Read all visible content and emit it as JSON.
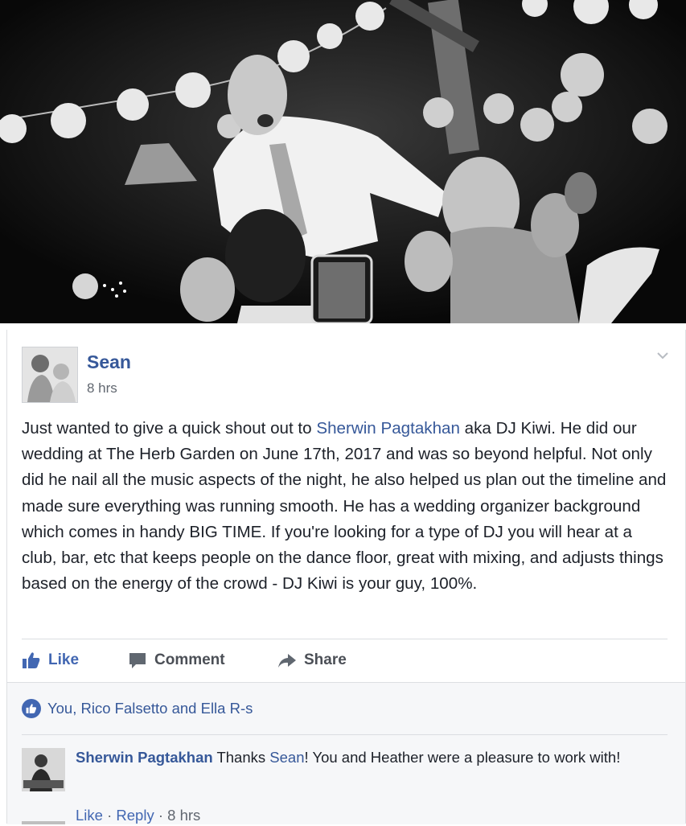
{
  "post": {
    "author": "Sean",
    "time": "8 hrs",
    "text_1": "Just wanted to give a quick shout out to ",
    "mention": "Sherwin Pagtakhan",
    "text_2": " aka DJ Kiwi. He did our wedding at The Herb Garden on June 17th, 2017 and was so beyond helpful. Not only did he nail all the music aspects of the night, he also helped us plan out the timeline and made sure everything was running smooth. He has a wedding organizer background which comes in handy BIG TIME. If you're looking for a type of DJ you will hear at a club, bar, etc that keeps people on the dance floor, great with mixing, and adjusts things based on the energy of the crowd - DJ Kiwi is your guy, 100%."
  },
  "actions": {
    "like": "Like",
    "comment": "Comment",
    "share": "Share"
  },
  "reactions": {
    "text": "You, Rico Falsetto and Ella R-s"
  },
  "comment": {
    "author": "Sherwin Pagtakhan",
    "text_1": " Thanks ",
    "mention": "Sean",
    "text_2": "! You and Heather were a pleasure to work with!",
    "like": "Like",
    "sep1": " · ",
    "reply": "Reply",
    "sep2": " · ",
    "time": "8 hrs"
  },
  "icons": {
    "like": "thumbs-up-icon",
    "comment": "speech-bubble-icon",
    "share": "share-arrow-icon",
    "reaction": "like-reaction-icon",
    "menu": "chevron-down-icon"
  },
  "colors": {
    "link": "#365899",
    "like_blue": "#4267b2",
    "text": "#1d2129",
    "meta": "#616770"
  }
}
